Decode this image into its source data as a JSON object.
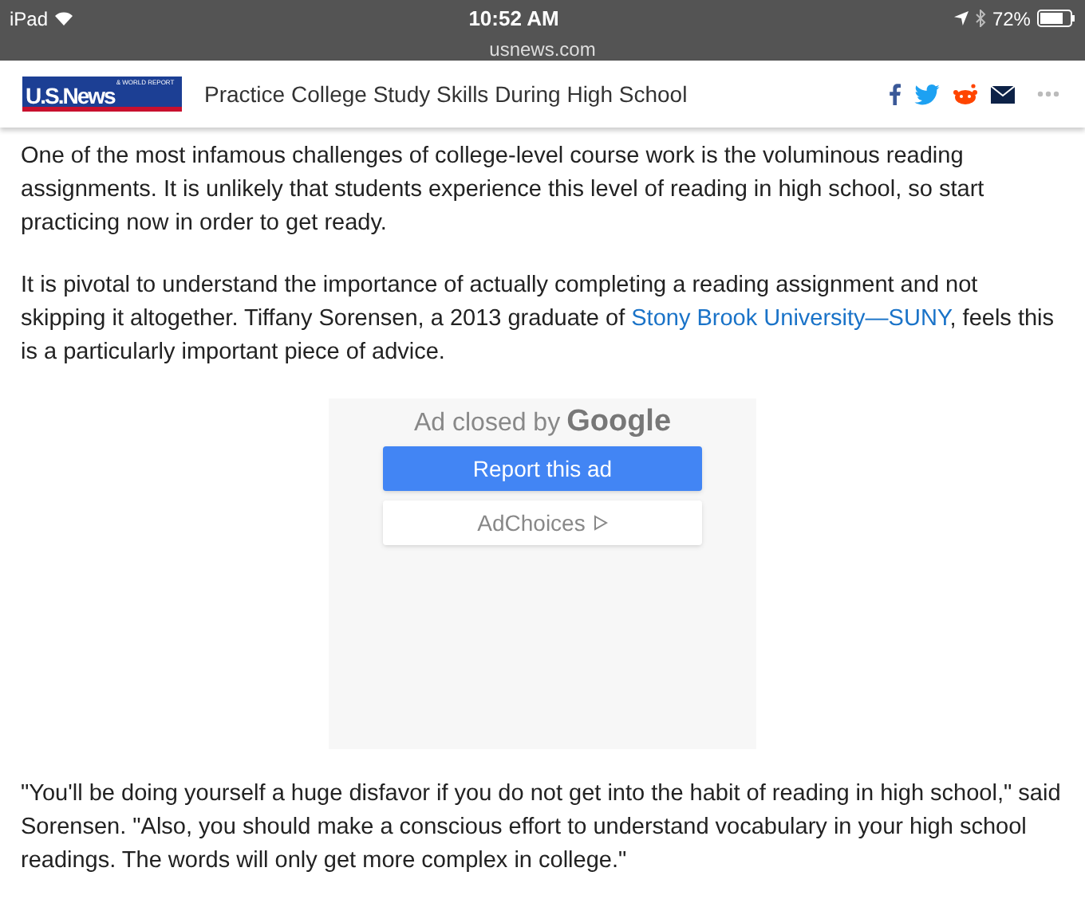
{
  "status_bar": {
    "device": "iPad",
    "time": "10:52 AM",
    "url": "usnews.com",
    "battery": "72%"
  },
  "header": {
    "logo": {
      "main": "U.S.News",
      "small": "& WORLD REPORT"
    },
    "title": "Practice College Study Skills During High School"
  },
  "paragraphs": [
    {
      "text": "One of the most infamous challenges of college-level course work is the voluminous reading assignments. It is unlikely that students experience this level of reading in high school, so start practicing now in order to get ready."
    },
    {
      "text": "It is pivotal to understand the importance of actually completing a reading assignment and not skipping it altogether. Tiffany Sorensen, a 2013 graduate of ",
      "link": "Stony Brook University—SUNY",
      "after": ", feels this is a particularly important piece of advice."
    }
  ],
  "ad": {
    "closed_by": "Ad closed by",
    "brand": "Google",
    "report_button": "Report this ad",
    "choices_button": "AdChoices"
  },
  "quote": {
    "text": "\"You'll be doing yourself a huge disfavor if you do not get into the habit of reading in high school,\" said Sorensen. \"Also, you should make a conscious effort to understand vocabulary in your high school readings. The words will only get more complex in college.\""
  }
}
